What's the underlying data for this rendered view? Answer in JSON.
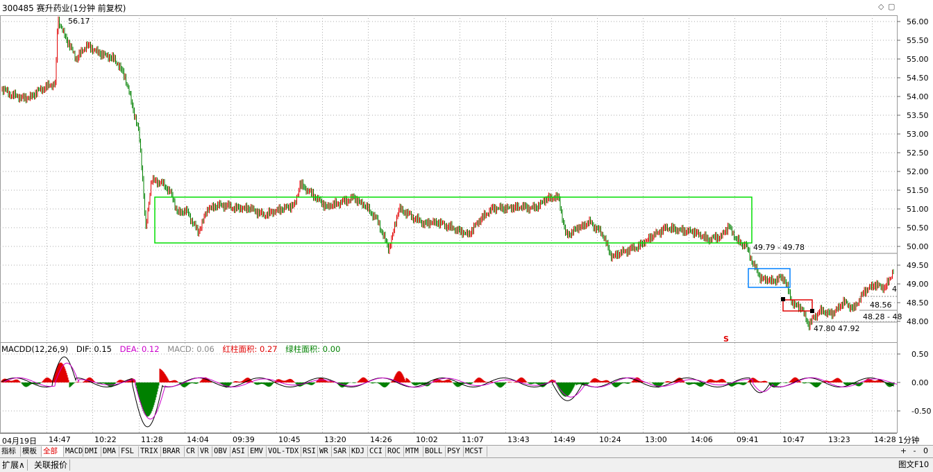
{
  "header": {
    "title": "300485 赛升药业(1分钟 前复权)",
    "high_label": "56.17",
    "low_label": "47.80",
    "low_label2": "47.92"
  },
  "price_axis": [
    "56.00",
    "55.50",
    "55.00",
    "54.50",
    "54.00",
    "53.50",
    "53.00",
    "52.50",
    "52.00",
    "51.50",
    "51.00",
    "50.50",
    "50.00",
    "49.50",
    "49.00",
    "48.50",
    "48.00"
  ],
  "annotations": {
    "range_label_1": "49.79 - 49.78",
    "range_label_2": "48.56",
    "range_label_3": "48.28 - 48",
    "edge_label": "4",
    "signal_mark": "S"
  },
  "macd": {
    "name": "MACDD(12,26,9)",
    "dif": "DIF: 0.15",
    "dea": "DEA: 0.12",
    "macd": "MACD: 0.06",
    "red_area": "红柱面积: 0.27",
    "green_area": "绿柱面积: 0.00",
    "axis": [
      "0.50",
      "0.00",
      "-0.50"
    ]
  },
  "time_axis": [
    "04月19日",
    "14:47",
    "10:22",
    "11:28",
    "14:04",
    "09:39",
    "10:45",
    "13:20",
    "14:26",
    "10:02",
    "11:07",
    "13:43",
    "14:49",
    "10:24",
    "13:00",
    "14:06",
    "09:41",
    "10:47",
    "13:23",
    "14:28"
  ],
  "period": "1分钟",
  "indicator_tabs": [
    "指标",
    "模板",
    "全部",
    "MACD",
    "DMI",
    "DMA",
    "FSL",
    "TRIX",
    "BRAR",
    "CR",
    "VR",
    "OBV",
    "ASI",
    "EMV",
    "VOL-TDX",
    "RSI",
    "WR",
    "SAR",
    "KDJ",
    "CCI",
    "ROC",
    "MTM",
    "BOLL",
    "PSY",
    "MCST"
  ],
  "active_tab": "全部",
  "zoom_buttons": [
    "+",
    "-",
    "0"
  ],
  "bottom_tabs": [
    "扩展∧",
    "关联报价"
  ],
  "f10_label": "图文F10",
  "colors": {
    "up": "#e00000",
    "down": "#008000",
    "box_green": "#00dd00",
    "box_blue": "#0080ff",
    "box_red": "#e00000",
    "dif": "#000000",
    "dea": "#cc00cc"
  }
}
